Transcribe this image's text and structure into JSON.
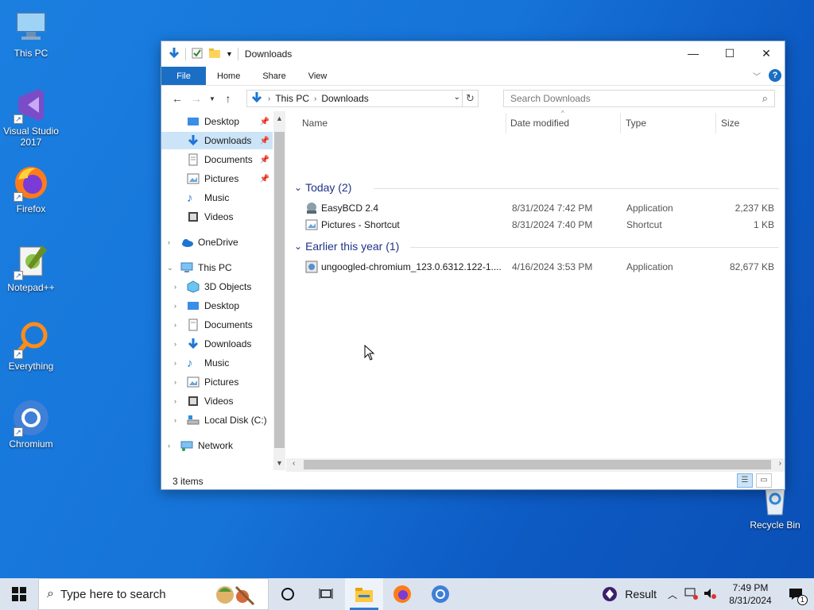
{
  "desktop": {
    "icons": [
      {
        "label": "This PC",
        "icon": "computer-icon"
      },
      {
        "label": "Visual Studio 2017",
        "icon": "visual-studio-icon"
      },
      {
        "label": "Firefox",
        "icon": "firefox-icon"
      },
      {
        "label": "Notepad++",
        "icon": "notepad-plus-plus-icon"
      },
      {
        "label": "Everything",
        "icon": "search-magnifier-icon"
      },
      {
        "label": "Chromium",
        "icon": "chromium-icon"
      },
      {
        "label": "Recycle Bin",
        "icon": "recycle-bin-icon"
      }
    ]
  },
  "window": {
    "title": "Downloads",
    "ribbon_tabs": {
      "file": "File",
      "home": "Home",
      "share": "Share",
      "view": "View"
    },
    "help": "?",
    "address": {
      "root": "This PC",
      "current": "Downloads"
    },
    "search_placeholder": "Search Downloads",
    "nav": {
      "quick_access": [
        {
          "label": "Desktop",
          "pinned": true
        },
        {
          "label": "Downloads",
          "pinned": true,
          "selected": true
        },
        {
          "label": "Documents",
          "pinned": true
        },
        {
          "label": "Pictures",
          "pinned": true
        },
        {
          "label": "Music"
        },
        {
          "label": "Videos"
        }
      ],
      "onedrive": "OneDrive",
      "this_pc": "This PC",
      "this_pc_children": [
        "3D Objects",
        "Desktop",
        "Documents",
        "Downloads",
        "Music",
        "Pictures",
        "Videos",
        "Local Disk (C:)"
      ],
      "network": "Network"
    },
    "columns": {
      "name": "Name",
      "date": "Date modified",
      "type": "Type",
      "size": "Size"
    },
    "groups": [
      {
        "header": "Today (2)",
        "files": [
          {
            "name": "EasyBCD 2.4",
            "date": "8/31/2024 7:42 PM",
            "type": "Application",
            "size": "2,237 KB"
          },
          {
            "name": "Pictures - Shortcut",
            "date": "8/31/2024 7:40 PM",
            "type": "Shortcut",
            "size": "1 KB"
          }
        ]
      },
      {
        "header": "Earlier this year (1)",
        "files": [
          {
            "name": "ungoogled-chromium_123.0.6312.122-1....",
            "date": "4/16/2024 3:53 PM",
            "type": "Application",
            "size": "82,677 KB"
          }
        ]
      }
    ],
    "status": "3 items"
  },
  "taskbar": {
    "search_placeholder": "Type here to search",
    "weather_label": "Result",
    "time": "7:49 PM",
    "date": "8/31/2024",
    "notification_count": "1"
  },
  "colors": {
    "accent": "#1a6fc4",
    "selection": "#cce4f7",
    "group_header": "#1e3287"
  }
}
